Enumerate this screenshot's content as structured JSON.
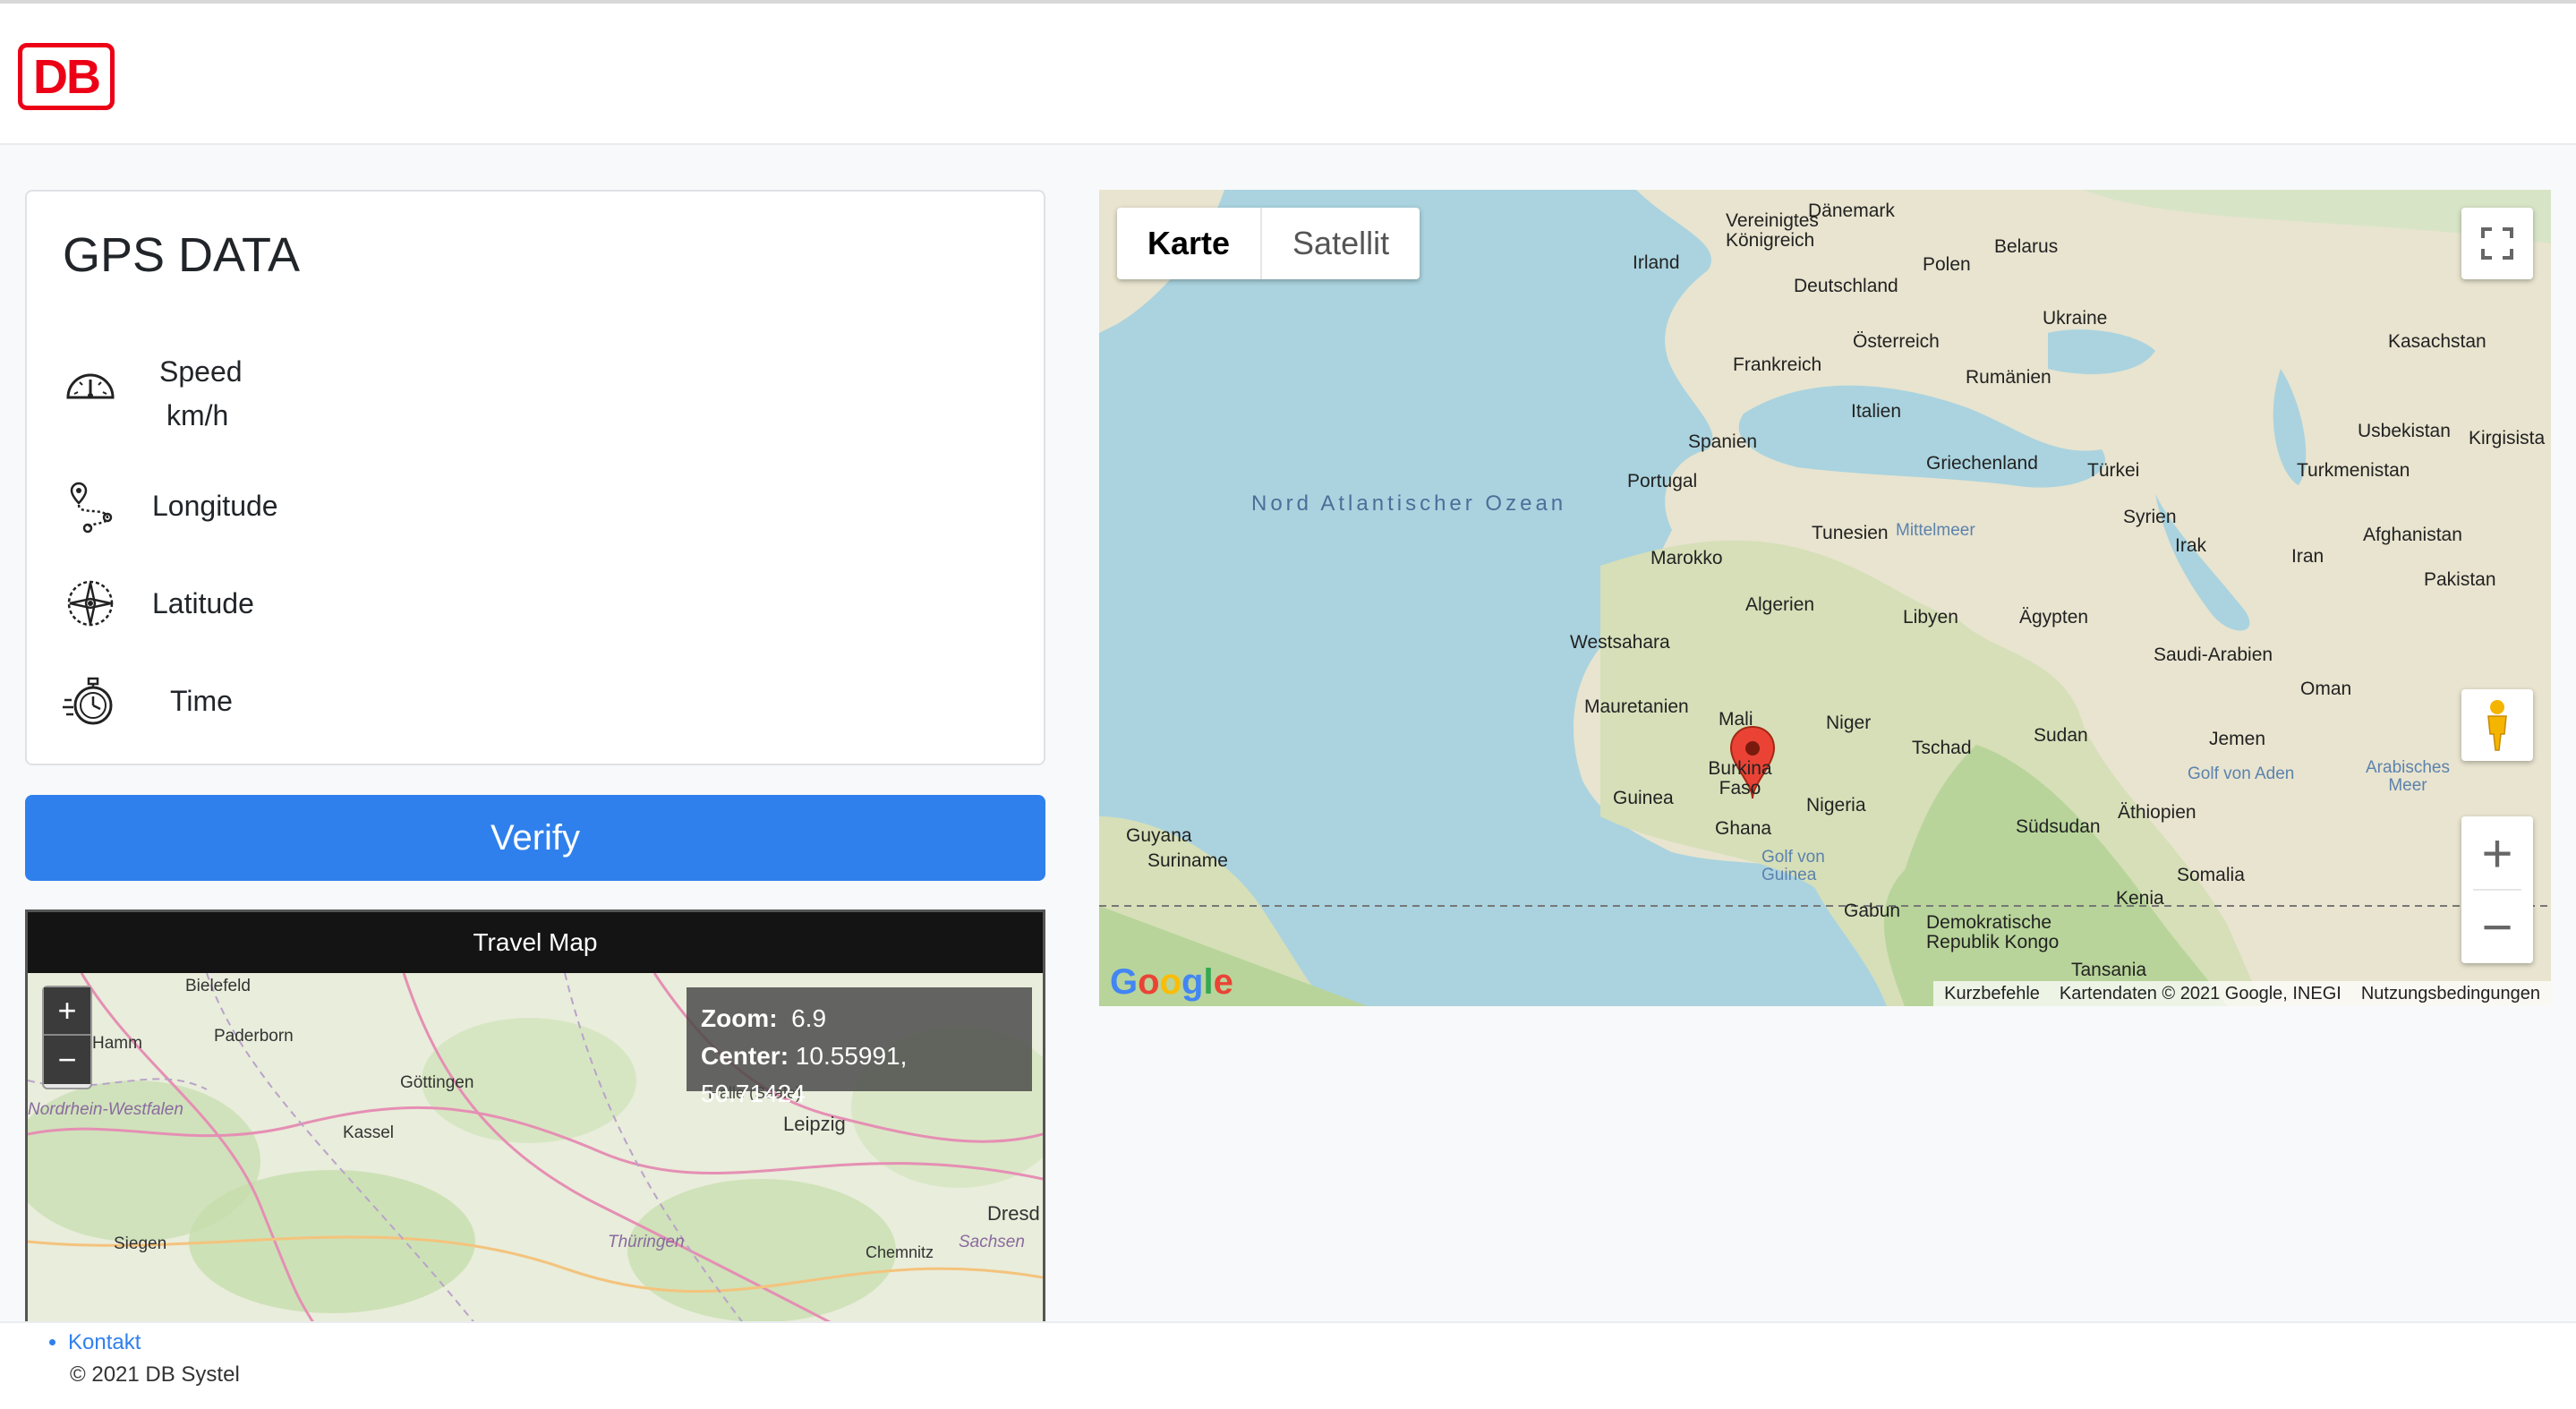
{
  "header": {
    "logo_text": "DB"
  },
  "gps_card": {
    "title": "GPS DATA",
    "speed_label": "Speed",
    "speed_unit": "km/h",
    "longitude_label": "Longitude",
    "latitude_label": "Latitude",
    "time_label": "Time"
  },
  "verify_label": "Verify",
  "travel_map": {
    "title": "Travel Map",
    "zoom_in": "+",
    "zoom_out": "−",
    "zoom_label": "Zoom:",
    "zoom_value": "6.9",
    "center_label": "Center:",
    "center_value": "10.55991, 50.71424",
    "places": [
      "Bielefeld",
      "Paderborn",
      "Göttingen",
      "Kassel",
      "Halle (Saale)",
      "Leipzig",
      "Siegen",
      "Thüringen",
      "Chemnitz",
      "Sachsen",
      "Dresd",
      "Nordrhein-Westfalen",
      "Hamm"
    ]
  },
  "google_map": {
    "toggle_map": "Karte",
    "toggle_satellite": "Satellit",
    "zoom_in": "+",
    "zoom_out": "−",
    "attribution": [
      "Kurzbefehle",
      "Kartendaten © 2021 Google, INEGI",
      "Nutzungsbedingungen"
    ],
    "logo": "Google",
    "ocean_label": "Nord Atlantischer Ozean",
    "countries": [
      {
        "name": "Dänemark"
      },
      {
        "name": "Vereinigtes Königreich"
      },
      {
        "name": "Irland"
      },
      {
        "name": "Belarus"
      },
      {
        "name": "Polen"
      },
      {
        "name": "Deutschland"
      },
      {
        "name": "Ukraine"
      },
      {
        "name": "Kasachstan"
      },
      {
        "name": "Österreich"
      },
      {
        "name": "Frankreich"
      },
      {
        "name": "Rumänien"
      },
      {
        "name": "Italien"
      },
      {
        "name": "Spanien"
      },
      {
        "name": "Usbekistan"
      },
      {
        "name": "Kirgisista"
      },
      {
        "name": "Portugal"
      },
      {
        "name": "Griechenland"
      },
      {
        "name": "Türkei"
      },
      {
        "name": "Turkmenistan"
      },
      {
        "name": "Tunesien"
      },
      {
        "name": "Syrien"
      },
      {
        "name": "Afghanistan"
      },
      {
        "name": "Irak"
      },
      {
        "name": "Iran"
      },
      {
        "name": "Marokko"
      },
      {
        "name": "Pakistan"
      },
      {
        "name": "Algerien"
      },
      {
        "name": "Libyen"
      },
      {
        "name": "Ägypten"
      },
      {
        "name": "Westsahara"
      },
      {
        "name": "Saudi-Arabien"
      },
      {
        "name": "Oman"
      },
      {
        "name": "Mauretanien"
      },
      {
        "name": "Mali"
      },
      {
        "name": "Niger"
      },
      {
        "name": "Sudan"
      },
      {
        "name": "Jemen"
      },
      {
        "name": "Tschad"
      },
      {
        "name": "Burkina Faso"
      },
      {
        "name": "Guinea"
      },
      {
        "name": "Nigeria"
      },
      {
        "name": "Äthiopien"
      },
      {
        "name": "Guyana"
      },
      {
        "name": "Südsudan"
      },
      {
        "name": "Suriname"
      },
      {
        "name": "Ghana"
      },
      {
        "name": "Somalia"
      },
      {
        "name": "Kenia"
      },
      {
        "name": "Gabun"
      },
      {
        "name": "Demokratische Republik Kongo"
      },
      {
        "name": "Tansania"
      }
    ],
    "waters": [
      "Mittelmeer",
      "Golf von Aden",
      "Arabisches Meer",
      "Golf von Guinea"
    ]
  },
  "footer": {
    "link": "Kontakt",
    "copyright": "© 2021 DB Systel"
  }
}
